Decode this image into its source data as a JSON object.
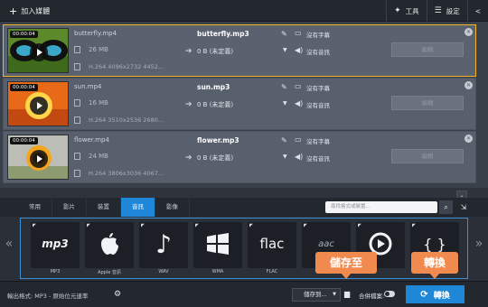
{
  "toolbar": {
    "add_media": "加入媒體",
    "tools": "工具",
    "settings": "設定"
  },
  "files": [
    {
      "duration": "00:00:04",
      "source_name": "butterfly.mp4",
      "source_size": "26 MB",
      "source_codec": "H.264 4096x2732 4452...",
      "output_name": "butterfly.mp3",
      "output_size": "0 B (未定義)",
      "subtitles": "沒有字幕",
      "audio": "沒有音訊",
      "edit": "編輯",
      "selected": true
    },
    {
      "duration": "00:00:04",
      "source_name": "sun.mp4",
      "source_size": "16 MB",
      "source_codec": "H.264 3510x2536 2680...",
      "output_name": "sun.mp3",
      "output_size": "0 B (未定義)",
      "subtitles": "沒有字幕",
      "audio": "沒有音訊",
      "edit": "編輯",
      "selected": false
    },
    {
      "duration": "00:00:04",
      "source_name": "flower.mp4",
      "source_size": "24 MB",
      "source_codec": "H.264 3806x3036 4067...",
      "output_name": "flower.mp3",
      "output_size": "0 B (未定義)",
      "subtitles": "沒有字幕",
      "audio": "沒有音訊",
      "edit": "編輯",
      "selected": false
    }
  ],
  "tabs": [
    "常用",
    "影片",
    "裝置",
    "音訊",
    "影像"
  ],
  "active_tab": "音訊",
  "search_placeholder": "尋找格式或裝置...",
  "presets": [
    {
      "label": "MP3",
      "logo": "mp3"
    },
    {
      "label": "Apple 音訊",
      "logo": ""
    },
    {
      "label": "WAV",
      "logo": "♪"
    },
    {
      "label": "WMA",
      "logo": ""
    },
    {
      "label": "FLAC",
      "logo": "flac"
    },
    {
      "label": "",
      "logo": "aac"
    },
    {
      "label": "",
      "logo": ""
    },
    {
      "label": "",
      "logo": "{ }"
    }
  ],
  "bottom": {
    "output_format": "輸出格式: MP3 - 原始位元速率",
    "save_to": "儲存到...",
    "merge_files": "合併檔案:",
    "convert": "轉換"
  },
  "callouts": {
    "save_to": "儲存至",
    "convert": "轉換"
  },
  "colors": {
    "accent": "#1e87d8",
    "selection": "#f1b52a",
    "callout": "#f08a4e"
  }
}
